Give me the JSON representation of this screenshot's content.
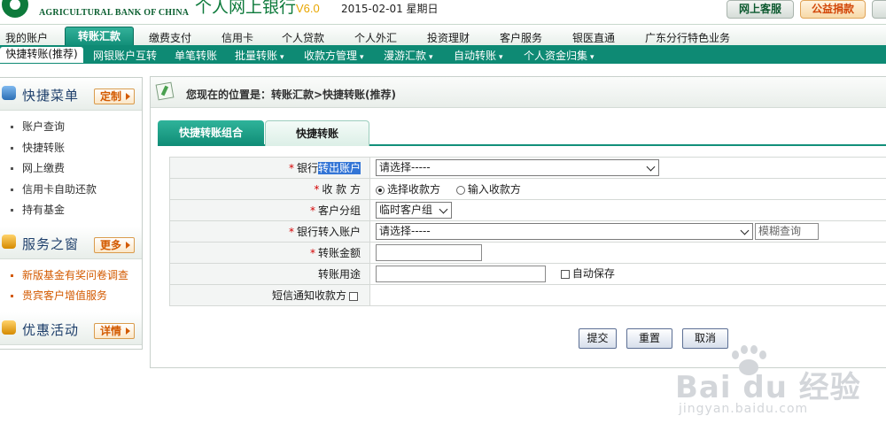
{
  "header": {
    "bank_name_en": "AGRICULTURAL BANK OF CHINA",
    "app_title": "个人网上银行",
    "version": "V6.0",
    "date": "2015-02-01 星期日",
    "buttons": {
      "service": "网上客服",
      "charity": "公益捐款"
    }
  },
  "main_nav": {
    "items": [
      "我的账户",
      "转账汇款",
      "缴费支付",
      "信用卡",
      "个人贷款",
      "个人外汇",
      "投资理财",
      "客户服务",
      "银医直通",
      "广东分行特色业务"
    ],
    "active": "转账汇款"
  },
  "sub_nav": {
    "items": [
      "快捷转账(推荐)",
      "网银账户互转",
      "单笔转账",
      "批量转账",
      "收款方管理",
      "漫游汇款",
      "自动转账",
      "个人资金归集"
    ],
    "active": "快捷转账(推荐)"
  },
  "sidebar": {
    "quick_menu": {
      "title": "快捷菜单",
      "button": "定制",
      "items": [
        "账户查询",
        "快捷转账",
        "网上缴费",
        "信用卡自助还款",
        "持有基金"
      ]
    },
    "service_window": {
      "title": "服务之窗",
      "button": "更多",
      "items": [
        "新版基金有奖问卷调查",
        "贵宾客户增值服务"
      ]
    },
    "promotions": {
      "title": "优惠活动",
      "button": "详情"
    }
  },
  "breadcrumb": {
    "text": "您现在的位置是：转账汇款>快捷转账(推荐)"
  },
  "tabs": {
    "combo": "快捷转账组合",
    "quick": "快捷转账"
  },
  "form": {
    "from_account": {
      "label_prefix": "银行",
      "label_highlight": "转出账户",
      "value": "请选择-----"
    },
    "payee": {
      "label": "收 款 方",
      "option_select": "选择收款方",
      "option_input": "输入收款方"
    },
    "customer_group": {
      "label": "客户分组",
      "value": "临时客户组"
    },
    "to_account": {
      "label": "银行转入账户",
      "value": "请选择-----",
      "search_placeholder": "模糊查询"
    },
    "amount": {
      "label": "转账金额",
      "value": ""
    },
    "purpose": {
      "label": "转账用途",
      "value": "",
      "auto_save": "自动保存"
    },
    "sms_notify": {
      "label": "短信通知收款方"
    }
  },
  "actions": {
    "submit": "提交",
    "reset": "重置",
    "cancel": "取消"
  },
  "watermark": {
    "text": "Bai du 经验",
    "url": "jingyan.baidu.com"
  }
}
